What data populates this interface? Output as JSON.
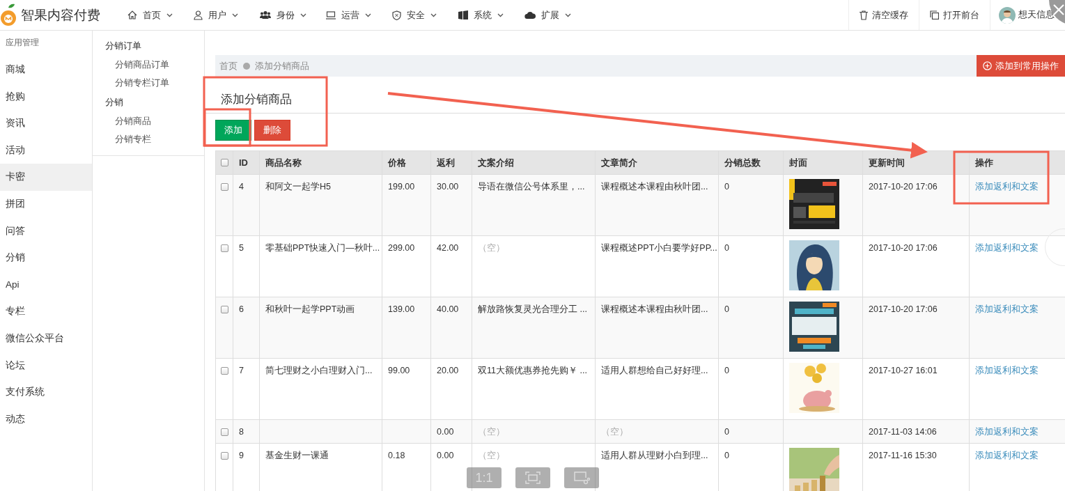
{
  "brand": {
    "name": "智果内容付费"
  },
  "nav": [
    {
      "label": "首页"
    },
    {
      "label": "用户"
    },
    {
      "label": "身份"
    },
    {
      "label": "运营"
    },
    {
      "label": "安全"
    },
    {
      "label": "系统"
    },
    {
      "label": "扩展"
    }
  ],
  "top_actions": [
    {
      "label": "清空缓存"
    },
    {
      "label": "打开前台"
    }
  ],
  "user": {
    "name": "想天信息"
  },
  "sidebar": {
    "header": "应用管理",
    "items": [
      {
        "label": "商城",
        "selected": false
      },
      {
        "label": "抢购",
        "selected": false
      },
      {
        "label": "资讯",
        "selected": false
      },
      {
        "label": "活动",
        "selected": false
      },
      {
        "label": "卡密",
        "selected": true
      },
      {
        "label": "拼团",
        "selected": false
      },
      {
        "label": "问答",
        "selected": false
      },
      {
        "label": "分销",
        "selected": false
      },
      {
        "label": "Api",
        "selected": false
      },
      {
        "label": "专栏",
        "selected": false
      },
      {
        "label": "微信公众平台",
        "selected": false
      },
      {
        "label": "论坛",
        "selected": false
      },
      {
        "label": "支付系统",
        "selected": false
      },
      {
        "label": "动态",
        "selected": false
      }
    ]
  },
  "submenu": [
    {
      "title": "分销订单",
      "items": [
        "分销商品订单",
        "分销专栏订单"
      ]
    },
    {
      "title": "分销",
      "items": [
        "分销商品",
        "分销专栏"
      ]
    }
  ],
  "breadcrumb": [
    "首页",
    "添加分销商品"
  ],
  "quick_add_button": "添加到常用操作",
  "page_title": "添加分销商品",
  "buttons": [
    {
      "label": "添加",
      "kind": "add"
    },
    {
      "label": "删除",
      "kind": "delete"
    }
  ],
  "table": {
    "select_all_checked": false,
    "columns": [
      "ID",
      "商品名称",
      "价格",
      "返利",
      "文案介绍",
      "文章简介",
      "分销总数",
      "封面",
      "更新时间",
      "操作"
    ],
    "rows": [
      {
        "checked": false,
        "id": "4",
        "name": "和阿文一起学H5",
        "price": "199.00",
        "rebate": "30.00",
        "intro": {
          "text": "导语在微信公号体系里，...",
          "empty": false
        },
        "summary": {
          "text": "课程概述本课程由秋叶团...",
          "empty": false
        },
        "total": "0",
        "cover": true,
        "time": "2017-10-20 17:06",
        "action": "添加返利和文案"
      },
      {
        "checked": false,
        "id": "5",
        "name": "零基础PPT快速入门—秋叶...",
        "price": "299.00",
        "rebate": "42.00",
        "intro": {
          "text": "（空）",
          "empty": true
        },
        "summary": {
          "text": "课程概述PPT小白要学好PP...",
          "empty": false
        },
        "total": "0",
        "cover": true,
        "time": "2017-10-20 17:06",
        "action": "添加返利和文案"
      },
      {
        "checked": false,
        "id": "6",
        "name": "和秋叶一起学PPT动画",
        "price": "139.00",
        "rebate": "40.00",
        "intro": {
          "text": "解放路恢复灵光合理分工 ...",
          "empty": false
        },
        "summary": {
          "text": "课程概述本课程由秋叶团...",
          "empty": false
        },
        "total": "0",
        "cover": true,
        "time": "2017-10-20 17:06",
        "action": "添加返利和文案"
      },
      {
        "checked": false,
        "id": "7",
        "name": "简七理财之小白理财入门...",
        "price": "99.00",
        "rebate": "20.00",
        "intro": {
          "text": "双11大额优惠券抢先购￥ ...",
          "empty": false
        },
        "summary": {
          "text": "适用人群想给自己好好理...",
          "empty": false
        },
        "total": "0",
        "cover": true,
        "time": "2017-10-27 16:01",
        "action": "添加返利和文案"
      },
      {
        "checked": false,
        "id": "8",
        "rebate": "0.00",
        "intro": {
          "text": "（空）",
          "empty": true
        },
        "summary": {
          "text": "（空）",
          "empty": true
        },
        "total": "0",
        "cover": false,
        "time": "2017-11-03 14:06",
        "action": "添加返利和文案"
      },
      {
        "checked": false,
        "id": "9",
        "name": "基金生财一课通",
        "price": "0.18",
        "rebate": "0.00",
        "intro": {
          "text": "（空）",
          "empty": true
        },
        "summary": {
          "text": "适用人群从理财小白到理...",
          "empty": false
        },
        "total": "0",
        "cover": true,
        "time": "2017-11-16 15:30",
        "action": "添加返利和文案"
      }
    ]
  },
  "viewer_toolbar": {
    "zoom_label": "1:1"
  }
}
